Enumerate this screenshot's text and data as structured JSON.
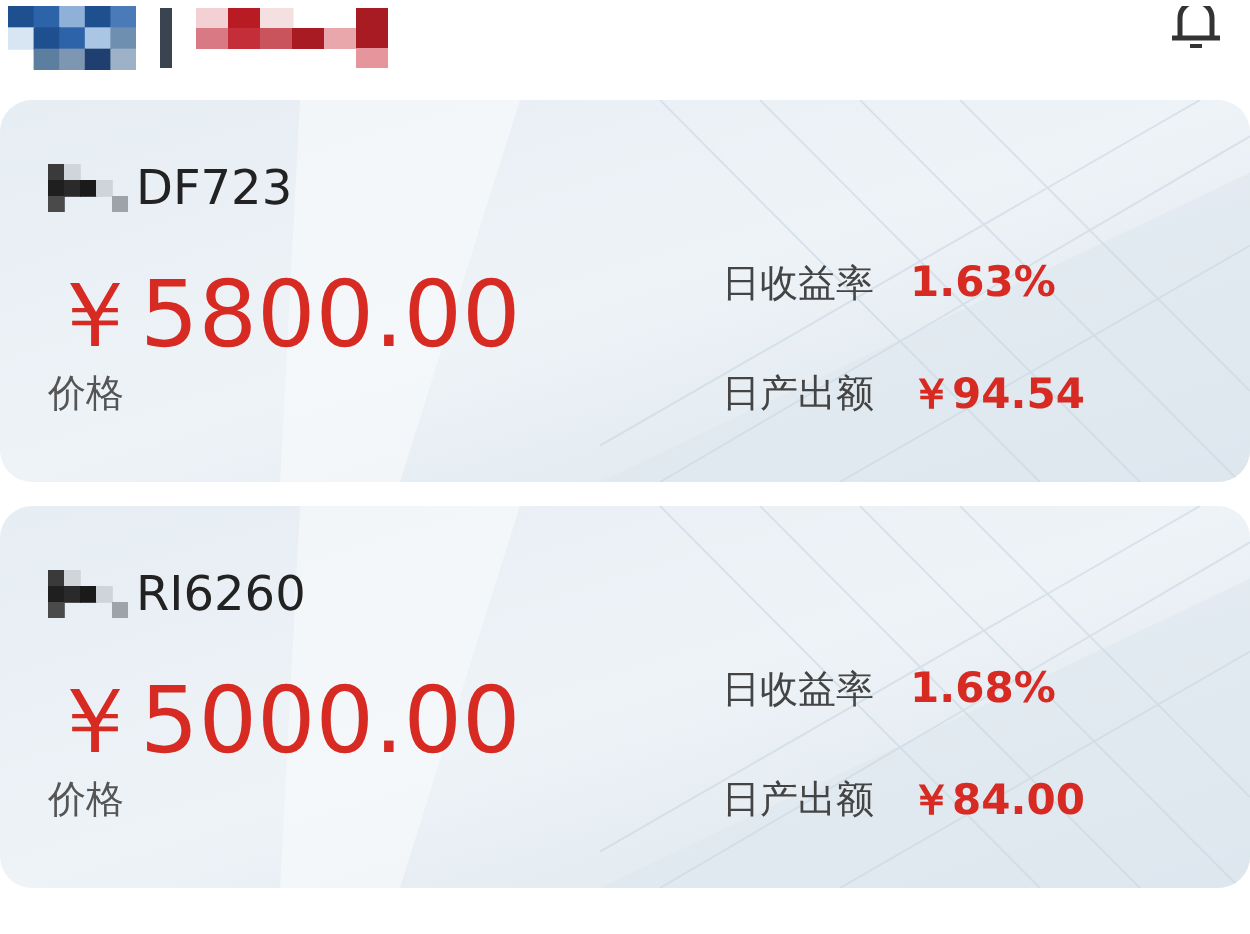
{
  "header": {
    "kind": "mosaic"
  },
  "cards": [
    {
      "name": "DF723",
      "price": "￥5800.00",
      "price_label": "价格",
      "stats": [
        {
          "label": "日收益率",
          "value": "1.63%"
        },
        {
          "label": "日产出额",
          "value": "￥94.54"
        }
      ]
    },
    {
      "name": "RI6260",
      "price": "￥5000.00",
      "price_label": "价格",
      "stats": [
        {
          "label": "日收益率",
          "value": "1.68%"
        },
        {
          "label": "日产出额",
          "value": "￥84.00"
        }
      ]
    }
  ]
}
